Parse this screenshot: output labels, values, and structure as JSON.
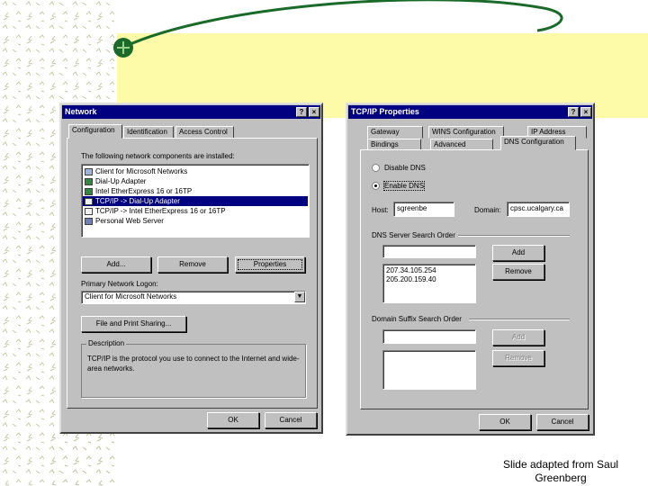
{
  "network_dialog": {
    "title": "Network",
    "tabs": [
      "Configuration",
      "Identification",
      "Access Control"
    ],
    "components_label": "The following network components are installed:",
    "components": [
      {
        "label": "Client for Microsoft Networks",
        "icon": "client-icon",
        "selected": false
      },
      {
        "label": "Dial-Up Adapter",
        "icon": "adapter-icon",
        "selected": false
      },
      {
        "label": "Intel EtherExpress 16 or 16TP",
        "icon": "adapter-icon",
        "selected": false
      },
      {
        "label": "TCP/IP -> Dial-Up Adapter",
        "icon": "protocol-icon",
        "selected": true
      },
      {
        "label": "TCP/IP -> Intel EtherExpress 16 or 16TP",
        "icon": "protocol-icon",
        "selected": false
      },
      {
        "label": "Personal Web Server",
        "icon": "service-icon",
        "selected": false
      }
    ],
    "add_label": "Add...",
    "remove_label": "Remove",
    "properties_label": "Properties",
    "logon_label": "Primary Network Logon:",
    "logon_value": "Client for Microsoft Networks",
    "file_print_label": "File and Print Sharing...",
    "description_title": "Description",
    "description_text": "TCP/IP is the protocol you use to connect to the Internet and wide-area networks.",
    "ok_label": "OK",
    "cancel_label": "Cancel"
  },
  "tcpip_dialog": {
    "title": "TCP/IP Properties",
    "tabs_back": [
      "Gateway",
      "WINS Configuration",
      "IP Address"
    ],
    "tabs_front": [
      "Bindings",
      "Advanced",
      "DNS Configuration"
    ],
    "disable_dns": "Disable DNS",
    "enable_dns": "Enable DNS",
    "host_label": "Host:",
    "host_value": "sgreenbe",
    "domain_label": "Domain:",
    "domain_value": "cpsc.ucalgary.ca",
    "domain_display": "cpsc.ucalgary.ca",
    "dns_order_label": "DNS Server Search Order",
    "dns_input": "",
    "dns_servers": [
      "207.34.105.254",
      "205.200.159.40"
    ],
    "suffix_label": "Domain Suffix Search Order",
    "suffix_input": "",
    "add_label": "Add",
    "remove_label": "Remove",
    "ok_label": "OK",
    "cancel_label": "Cancel"
  },
  "caption": {
    "line1": "Slide adapted from Saul",
    "line2": "Greenberg"
  }
}
